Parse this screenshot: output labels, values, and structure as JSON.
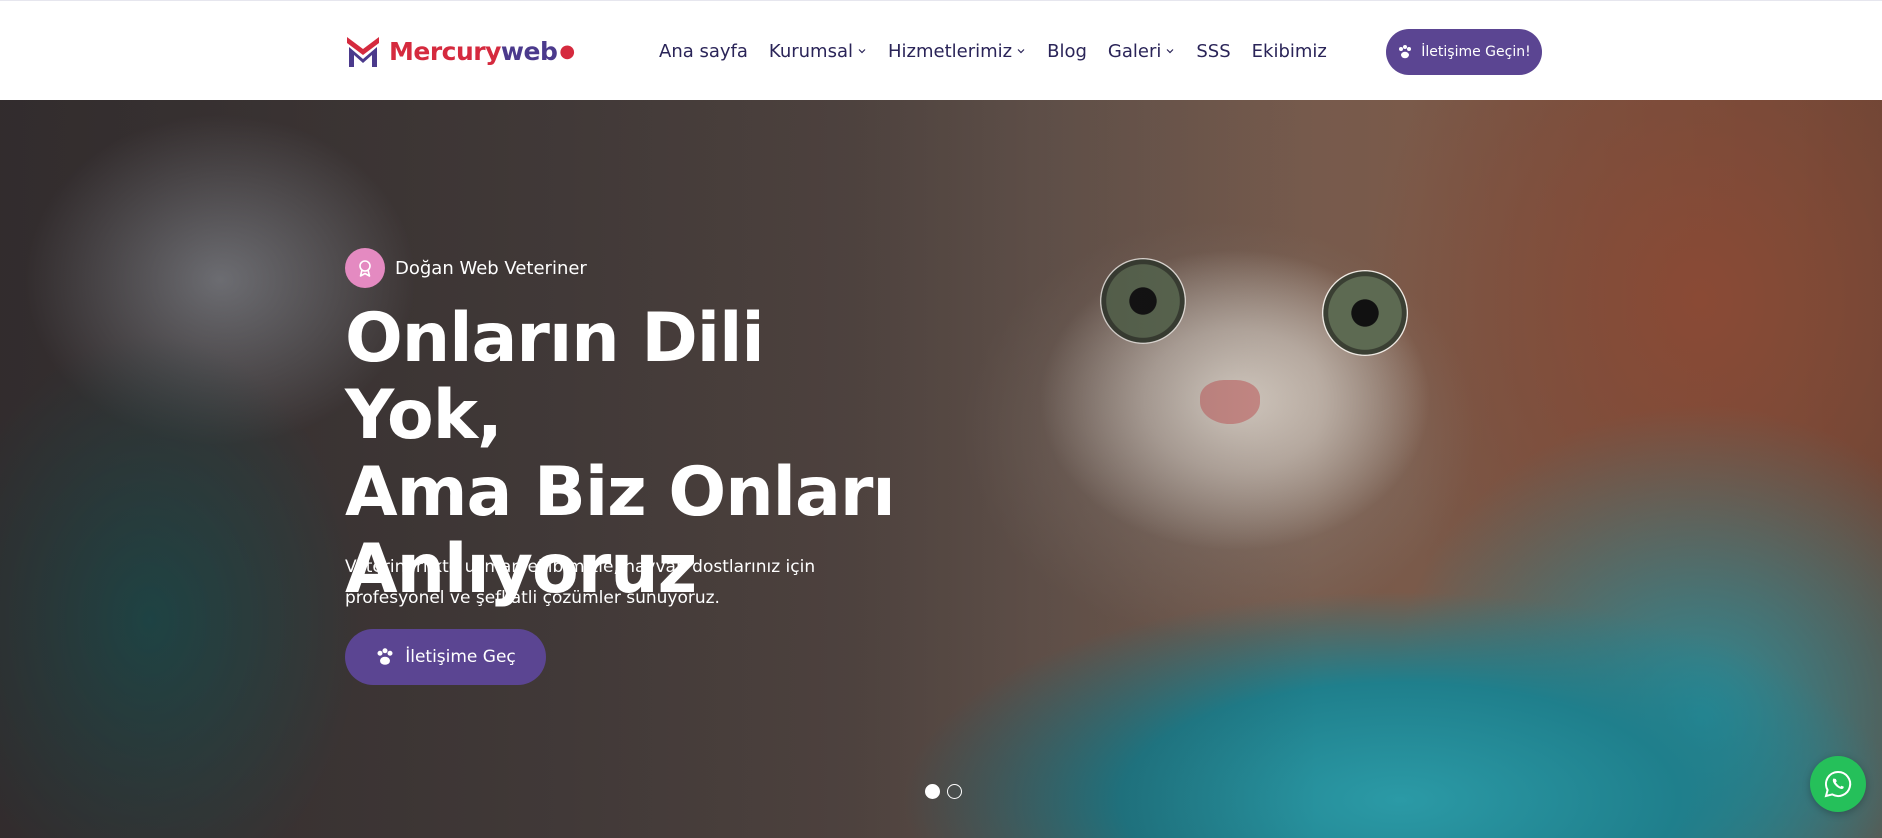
{
  "header": {
    "logo": {
      "part1": "Mercury",
      "part2": "web",
      "dot": "●"
    },
    "nav": [
      {
        "label": "Ana sayfa",
        "dropdown": false
      },
      {
        "label": "Kurumsal",
        "dropdown": true
      },
      {
        "label": "Hizmetlerimiz",
        "dropdown": true
      },
      {
        "label": "Blog",
        "dropdown": false
      },
      {
        "label": "Galeri",
        "dropdown": true
      },
      {
        "label": "SSS",
        "dropdown": false
      },
      {
        "label": "Ekibimiz",
        "dropdown": false
      }
    ],
    "cta_label": "İletişime Geçin!"
  },
  "hero": {
    "eyebrow": "Doğan Web Veteriner",
    "title_line1": "Onların Dili Yok,",
    "title_line2": "Ama Biz Onları",
    "title_line3": "Anlıyoruz",
    "description": "Veterinerlikte uzman ekibimizle, hayvan dostlarınız için profesyonel ve şefkatli çözümler sunuyoruz.",
    "cta_label": "İletişime Geç",
    "slides": {
      "count": 2,
      "active": 1
    }
  },
  "icons": {
    "logo": "mercury-logo-mark",
    "chevron": "chevron-down-icon",
    "paw": "paw-icon",
    "badge": "award-badge-icon",
    "whatsapp": "whatsapp-icon"
  },
  "colors": {
    "primary": "#5b4592",
    "nav_text": "#2a2458",
    "logo_red": "#d52a3e",
    "logo_purple": "#4b3a8c",
    "badge_pink": "#e48ac1",
    "whatsapp_green": "#25c05a"
  }
}
